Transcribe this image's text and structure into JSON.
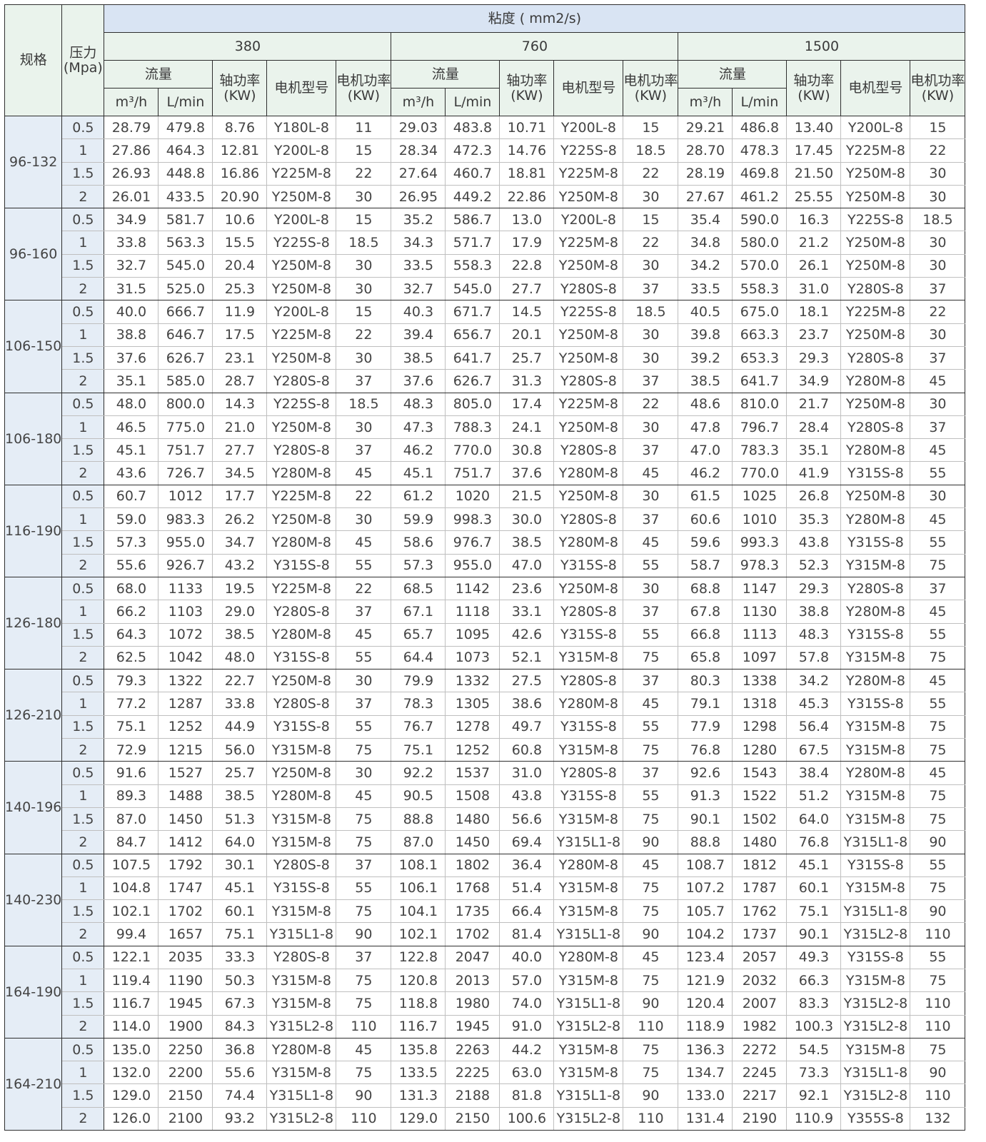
{
  "header": {
    "spec": "规格",
    "pressure": "压力\n(Mpa)",
    "viscosity": "粘度 ( mm2/s)",
    "viscosity_values": [
      "380",
      "760",
      "1500"
    ],
    "flow": "流量",
    "shaft_power": "轴功率\n(KW)",
    "motor_model": "电机型号",
    "motor_power": "电机功率\n(KW)",
    "unit_m3h": "m³/h",
    "unit_lmin": "L/min"
  },
  "groups": [
    {
      "spec": "96-132",
      "rows": [
        [
          "0.5",
          "28.79",
          "479.8",
          "8.76",
          "Y180L-8",
          "11",
          "29.03",
          "483.8",
          "10.71",
          "Y200L-8",
          "15",
          "29.21",
          "486.8",
          "13.40",
          "Y200L-8",
          "15"
        ],
        [
          "1",
          "27.86",
          "464.3",
          "12.81",
          "Y200L-8",
          "15",
          "28.34",
          "472.3",
          "14.76",
          "Y225S-8",
          "18.5",
          "28.70",
          "478.3",
          "17.45",
          "Y225M-8",
          "22"
        ],
        [
          "1.5",
          "26.93",
          "448.8",
          "16.86",
          "Y225M-8",
          "22",
          "27.64",
          "460.7",
          "18.81",
          "Y225M-8",
          "22",
          "28.19",
          "469.8",
          "21.50",
          "Y250M-8",
          "30"
        ],
        [
          "2",
          "26.01",
          "433.5",
          "20.90",
          "Y250M-8",
          "30",
          "26.95",
          "449.2",
          "22.86",
          "Y250M-8",
          "30",
          "27.67",
          "461.2",
          "25.55",
          "Y250M-8",
          "30"
        ]
      ]
    },
    {
      "spec": "96-160",
      "rows": [
        [
          "0.5",
          "34.9",
          "581.7",
          "10.6",
          "Y200L-8",
          "15",
          "35.2",
          "586.7",
          "13.0",
          "Y200L-8",
          "15",
          "35.4",
          "590.0",
          "16.3",
          "Y225S-8",
          "18.5"
        ],
        [
          "1",
          "33.8",
          "563.3",
          "15.5",
          "Y225S-8",
          "18.5",
          "34.3",
          "571.7",
          "17.9",
          "Y225M-8",
          "22",
          "34.8",
          "580.0",
          "21.2",
          "Y250M-8",
          "30"
        ],
        [
          "1.5",
          "32.7",
          "545.0",
          "20.4",
          "Y250M-8",
          "30",
          "33.5",
          "558.3",
          "22.8",
          "Y250M-8",
          "30",
          "34.2",
          "570.0",
          "26.1",
          "Y250M-8",
          "30"
        ],
        [
          "2",
          "31.5",
          "525.0",
          "25.3",
          "Y250M-8",
          "30",
          "32.7",
          "545.0",
          "27.7",
          "Y280S-8",
          "37",
          "33.5",
          "558.3",
          "31.0",
          "Y280S-8",
          "37"
        ]
      ]
    },
    {
      "spec": "106-150",
      "rows": [
        [
          "0.5",
          "40.0",
          "666.7",
          "11.9",
          "Y200L-8",
          "15",
          "40.3",
          "671.7",
          "14.5",
          "Y225S-8",
          "18.5",
          "40.5",
          "675.0",
          "18.1",
          "Y225M-8",
          "22"
        ],
        [
          "1",
          "38.8",
          "646.7",
          "17.5",
          "Y225M-8",
          "22",
          "39.4",
          "656.7",
          "20.1",
          "Y250M-8",
          "30",
          "39.8",
          "663.3",
          "23.7",
          "Y250M-8",
          "30"
        ],
        [
          "1.5",
          "37.6",
          "626.7",
          "23.1",
          "Y250M-8",
          "30",
          "38.5",
          "641.7",
          "25.7",
          "Y250M-8",
          "30",
          "39.2",
          "653.3",
          "29.3",
          "Y280S-8",
          "37"
        ],
        [
          "2",
          "35.1",
          "585.0",
          "28.7",
          "Y280S-8",
          "37",
          "37.6",
          "626.7",
          "31.3",
          "Y280S-8",
          "37",
          "38.5",
          "641.7",
          "34.9",
          "Y280M-8",
          "45"
        ]
      ]
    },
    {
      "spec": "106-180",
      "rows": [
        [
          "0.5",
          "48.0",
          "800.0",
          "14.3",
          "Y225S-8",
          "18.5",
          "48.3",
          "805.0",
          "17.4",
          "Y225M-8",
          "22",
          "48.6",
          "810.0",
          "21.7",
          "Y250M-8",
          "30"
        ],
        [
          "1",
          "46.5",
          "775.0",
          "21.0",
          "Y250M-8",
          "30",
          "47.3",
          "788.3",
          "24.1",
          "Y250M-8",
          "30",
          "47.8",
          "796.7",
          "28.4",
          "Y280S-8",
          "37"
        ],
        [
          "1.5",
          "45.1",
          "751.7",
          "27.7",
          "Y280S-8",
          "37",
          "46.2",
          "770.0",
          "30.8",
          "Y280S-8",
          "37",
          "47.0",
          "783.3",
          "35.1",
          "Y280M-8",
          "45"
        ],
        [
          "2",
          "43.6",
          "726.7",
          "34.5",
          "Y280M-8",
          "45",
          "45.1",
          "751.7",
          "37.6",
          "Y280M-8",
          "45",
          "46.2",
          "770.0",
          "41.9",
          "Y315S-8",
          "55"
        ]
      ]
    },
    {
      "spec": "116-190",
      "rows": [
        [
          "0.5",
          "60.7",
          "1012",
          "17.7",
          "Y225M-8",
          "22",
          "61.2",
          "1020",
          "21.5",
          "Y250M-8",
          "30",
          "61.5",
          "1025",
          "26.8",
          "Y250M-8",
          "30"
        ],
        [
          "1",
          "59.0",
          "983.3",
          "26.2",
          "Y250M-8",
          "30",
          "59.9",
          "998.3",
          "30.0",
          "Y280S-8",
          "37",
          "60.6",
          "1010",
          "35.3",
          "Y280M-8",
          "45"
        ],
        [
          "1.5",
          "57.3",
          "955.0",
          "34.7",
          "Y280M-8",
          "45",
          "58.6",
          "976.7",
          "38.5",
          "Y280M-8",
          "45",
          "59.6",
          "993.3",
          "43.8",
          "Y315S-8",
          "55"
        ],
        [
          "2",
          "55.6",
          "926.7",
          "43.2",
          "Y315S-8",
          "55",
          "57.3",
          "955.0",
          "47.0",
          "Y315S-8",
          "55",
          "58.7",
          "978.3",
          "52.3",
          "Y315M-8",
          "75"
        ]
      ]
    },
    {
      "spec": "126-180",
      "rows": [
        [
          "0.5",
          "68.0",
          "1133",
          "19.5",
          "Y225M-8",
          "22",
          "68.5",
          "1142",
          "23.6",
          "Y250M-8",
          "30",
          "68.8",
          "1147",
          "29.3",
          "Y280S-8",
          "37"
        ],
        [
          "1",
          "66.2",
          "1103",
          "29.0",
          "Y280S-8",
          "37",
          "67.1",
          "1118",
          "33.1",
          "Y280S-8",
          "37",
          "67.8",
          "1130",
          "38.8",
          "Y280M-8",
          "45"
        ],
        [
          "1.5",
          "64.3",
          "1072",
          "38.5",
          "Y280M-8",
          "45",
          "65.7",
          "1095",
          "42.6",
          "Y315S-8",
          "55",
          "66.8",
          "1113",
          "48.3",
          "Y315S-8",
          "55"
        ],
        [
          "2",
          "62.5",
          "1042",
          "48.0",
          "Y315S-8",
          "55",
          "64.4",
          "1073",
          "52.1",
          "Y315M-8",
          "75",
          "65.8",
          "1097",
          "57.8",
          "Y315M-8",
          "75"
        ]
      ]
    },
    {
      "spec": "126-210",
      "rows": [
        [
          "0.5",
          "79.3",
          "1322",
          "22.7",
          "Y250M-8",
          "30",
          "79.9",
          "1332",
          "27.5",
          "Y280S-8",
          "37",
          "80.3",
          "1338",
          "34.2",
          "Y280M-8",
          "45"
        ],
        [
          "1",
          "77.2",
          "1287",
          "33.8",
          "Y280S-8",
          "37",
          "78.3",
          "1305",
          "38.6",
          "Y280M-8",
          "45",
          "79.1",
          "1318",
          "45.3",
          "Y315S-8",
          "55"
        ],
        [
          "1.5",
          "75.1",
          "1252",
          "44.9",
          "Y315S-8",
          "55",
          "76.7",
          "1278",
          "49.7",
          "Y315S-8",
          "55",
          "77.9",
          "1298",
          "56.4",
          "Y315M-8",
          "75"
        ],
        [
          "2",
          "72.9",
          "1215",
          "56.0",
          "Y315M-8",
          "75",
          "75.1",
          "1252",
          "60.8",
          "Y315M-8",
          "75",
          "76.8",
          "1280",
          "67.5",
          "Y315M-8",
          "75"
        ]
      ]
    },
    {
      "spec": "140-196",
      "rows": [
        [
          "0.5",
          "91.6",
          "1527",
          "25.7",
          "Y250M-8",
          "30",
          "92.2",
          "1537",
          "31.0",
          "Y280S-8",
          "37",
          "92.6",
          "1543",
          "38.4",
          "Y280M-8",
          "45"
        ],
        [
          "1",
          "89.3",
          "1488",
          "38.5",
          "Y280M-8",
          "45",
          "90.5",
          "1508",
          "43.8",
          "Y315S-8",
          "55",
          "91.3",
          "1522",
          "51.2",
          "Y315M-8",
          "75"
        ],
        [
          "1.5",
          "87.0",
          "1450",
          "51.3",
          "Y315M-8",
          "75",
          "88.8",
          "1480",
          "56.6",
          "Y315M-8",
          "75",
          "90.1",
          "1502",
          "64.0",
          "Y315M-8",
          "75"
        ],
        [
          "2",
          "84.7",
          "1412",
          "64.0",
          "Y315M-8",
          "75",
          "87.0",
          "1450",
          "69.4",
          "Y315L1-8",
          "90",
          "88.8",
          "1480",
          "76.8",
          "Y315L1-8",
          "90"
        ]
      ]
    },
    {
      "spec": "140-230",
      "rows": [
        [
          "0.5",
          "107.5",
          "1792",
          "30.1",
          "Y280S-8",
          "37",
          "108.1",
          "1802",
          "36.4",
          "Y280M-8",
          "45",
          "108.7",
          "1812",
          "45.1",
          "Y315S-8",
          "55"
        ],
        [
          "1",
          "104.8",
          "1747",
          "45.1",
          "Y315S-8",
          "55",
          "106.1",
          "1768",
          "51.4",
          "Y315M-8",
          "75",
          "107.2",
          "1787",
          "60.1",
          "Y315M-8",
          "75"
        ],
        [
          "1.5",
          "102.1",
          "1702",
          "60.1",
          "Y315M-8",
          "75",
          "104.1",
          "1735",
          "66.4",
          "Y315M-8",
          "75",
          "105.7",
          "1762",
          "75.1",
          "Y315L1-8",
          "90"
        ],
        [
          "2",
          "99.4",
          "1657",
          "75.1",
          "Y315L1-8",
          "90",
          "102.1",
          "1702",
          "81.4",
          "Y315L1-8",
          "90",
          "104.2",
          "1737",
          "90.1",
          "Y315L2-8",
          "110"
        ]
      ]
    },
    {
      "spec": "164-190",
      "rows": [
        [
          "0.5",
          "122.1",
          "2035",
          "33.3",
          "Y280S-8",
          "37",
          "122.8",
          "2047",
          "40.0",
          "Y280M-8",
          "45",
          "123.4",
          "2057",
          "49.3",
          "Y315S-8",
          "55"
        ],
        [
          "1",
          "119.4",
          "1190",
          "50.3",
          "Y315M-8",
          "75",
          "120.8",
          "2013",
          "57.0",
          "Y315M-8",
          "75",
          "121.9",
          "2032",
          "66.3",
          "Y315M-8",
          "75"
        ],
        [
          "1.5",
          "116.7",
          "1945",
          "67.3",
          "Y315M-8",
          "75",
          "118.8",
          "1980",
          "74.0",
          "Y315L1-8",
          "90",
          "120.4",
          "2007",
          "83.3",
          "Y315L2-8",
          "110"
        ],
        [
          "2",
          "114.0",
          "1900",
          "84.3",
          "Y315L2-8",
          "110",
          "116.7",
          "1945",
          "91.0",
          "Y315L2-8",
          "110",
          "118.9",
          "1982",
          "100.3",
          "Y315L2-8",
          "110"
        ]
      ]
    },
    {
      "spec": "164-210",
      "rows": [
        [
          "0.5",
          "135.0",
          "2250",
          "36.8",
          "Y280M-8",
          "45",
          "135.8",
          "2263",
          "44.2",
          "Y315M-8",
          "75",
          "136.3",
          "2272",
          "54.5",
          "Y315M-8",
          "75"
        ],
        [
          "1",
          "132.0",
          "2200",
          "55.6",
          "Y315M-8",
          "75",
          "133.5",
          "2225",
          "63.0",
          "Y315M-8",
          "75",
          "134.7",
          "2245",
          "73.3",
          "Y315L1-8",
          "90"
        ],
        [
          "1.5",
          "129.0",
          "2150",
          "74.4",
          "Y315L1-8",
          "90",
          "131.3",
          "2188",
          "81.8",
          "Y315L1-8",
          "90",
          "133.0",
          "2217",
          "92.1",
          "Y315L2-8",
          "110"
        ],
        [
          "2",
          "126.0",
          "2100",
          "93.2",
          "Y315L2-8",
          "110",
          "129.0",
          "2150",
          "100.6",
          "Y315L2-8",
          "110",
          "131.4",
          "2190",
          "110.9",
          "Y355S-8",
          "132"
        ]
      ]
    }
  ]
}
